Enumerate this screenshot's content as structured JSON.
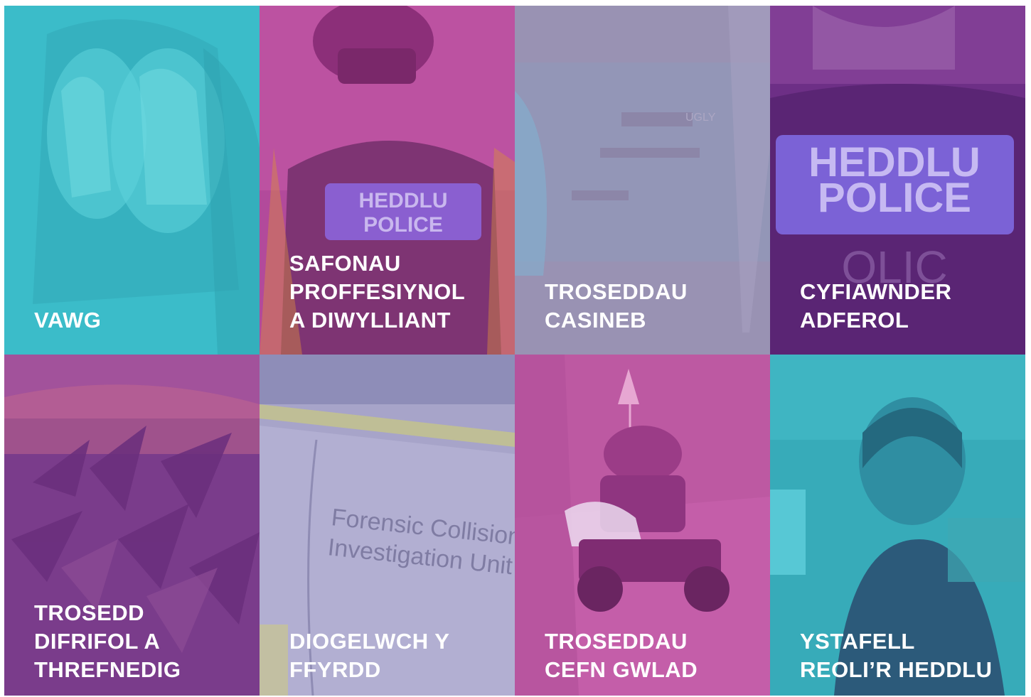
{
  "tiles": [
    {
      "id": "vawg",
      "label": "VAWG",
      "color": "#3fc4d0",
      "icon": "hands-over-face-photo"
    },
    {
      "id": "safonau",
      "label": "SAFONAU\nPROFFESIYNOL\nA DIWYLLIANT",
      "color": "#b5479a",
      "icon": "police-officer-back-photo",
      "badge": "HEDDLU\nPOLICE"
    },
    {
      "id": "troseddau-casineb",
      "label": "TROSEDDAU\nCASINEB",
      "color": "#9b93b4",
      "icon": "window-reflection-photo",
      "glass_text": "UGLY"
    },
    {
      "id": "cyfiawnder",
      "label": "CYFIAWNDER\nADFEROL",
      "color": "#6e2f86",
      "icon": "police-officer-back-photo",
      "badge": "HEDDLU\nPOLICE",
      "vest_text": "OLIC"
    },
    {
      "id": "trosedd-difrifol",
      "label": "TROSEDD\nDIFRIFOL A\nTHREFNEDIG",
      "color": "#7b3d8c",
      "icon": "cannabis-plant-photo"
    },
    {
      "id": "diogelwch",
      "label": "DIOGELWCH Y\nFFYRDD",
      "color": "#a9a6cb",
      "icon": "police-van-photo",
      "van_text": "Forensic Collision\nInvestigation Unit"
    },
    {
      "id": "troseddau-cefn-gwlad",
      "label": "TROSEDDAU\nCEFN GWLAD",
      "color": "#c45ea9",
      "icon": "quad-bike-dog-photo"
    },
    {
      "id": "ystafell",
      "label": "YSTAFELL\nREOLI’R HEDDLU",
      "color": "#36aab8",
      "icon": "control-room-operator-photo"
    }
  ]
}
